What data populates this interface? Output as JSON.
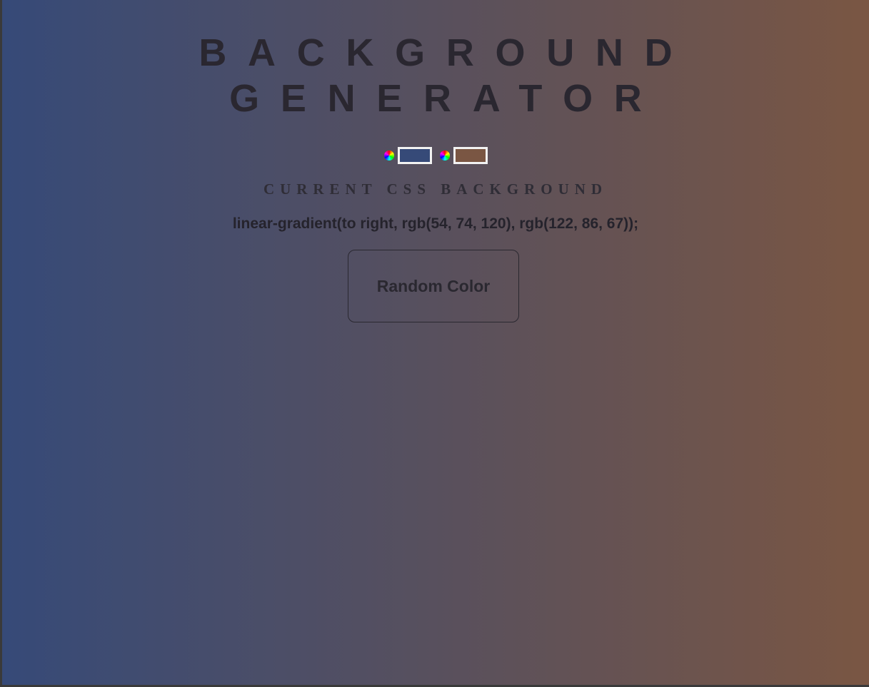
{
  "header": {
    "title_line1": "BACKGROUND",
    "title_line2": "GENERATOR"
  },
  "pickers": [
    {
      "icon": "color-wheel-icon",
      "value": "#364a78"
    },
    {
      "icon": "color-wheel-icon",
      "value": "#7a5643"
    }
  ],
  "subtitle": "CURRENT CSS BACKGROUND",
  "css_value": "linear-gradient(to right, rgb(54, 74, 120), rgb(122, 86, 67));",
  "random_button": {
    "label": "Random Color"
  },
  "colors": {
    "gradient_start": "#364a78",
    "gradient_end": "#7a5643",
    "text": "#27252e"
  }
}
